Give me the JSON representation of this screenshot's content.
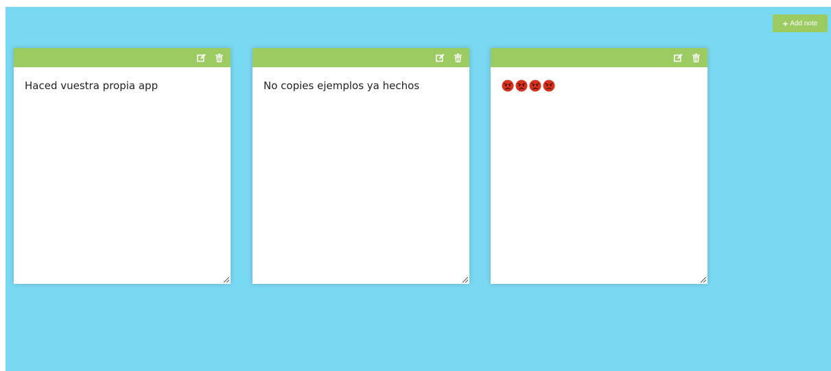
{
  "toolbar": {
    "add_note_label": "Add note",
    "add_note_icon": "plus-icon",
    "accent_color": "#9ccb62",
    "background_color": "#7ad9f2"
  },
  "notes": [
    {
      "text": "Haced vuestra propia app",
      "edit_icon": "edit-icon",
      "delete_icon": "trash-icon"
    },
    {
      "text": "No copies ejemplos ya hechos",
      "edit_icon": "edit-icon",
      "delete_icon": "trash-icon"
    },
    {
      "text": "😡😡😡😡",
      "edit_icon": "edit-icon",
      "delete_icon": "trash-icon",
      "emoji": "angry-face-icon",
      "emoji_count": 4
    }
  ]
}
